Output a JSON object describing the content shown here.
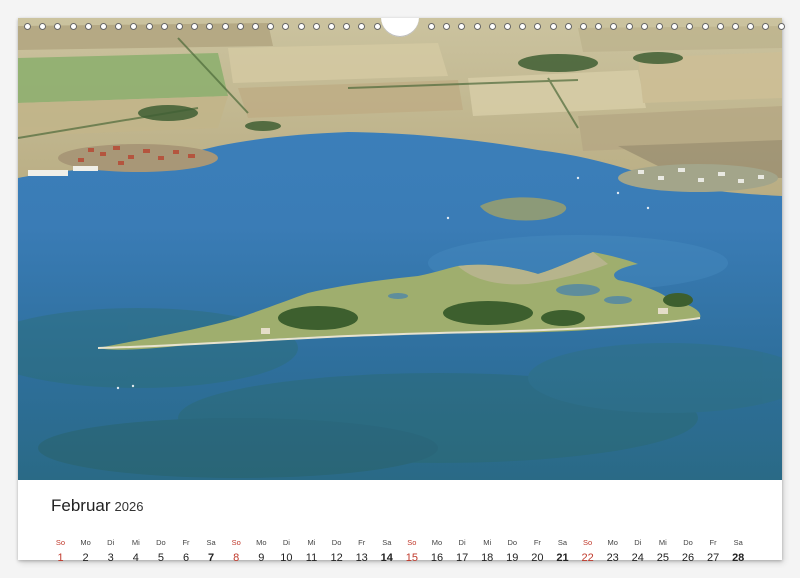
{
  "calendar": {
    "month": "Februar",
    "year": "2026",
    "days": [
      {
        "dow": "So",
        "num": "1"
      },
      {
        "dow": "Mo",
        "num": "2"
      },
      {
        "dow": "Di",
        "num": "3"
      },
      {
        "dow": "Mi",
        "num": "4"
      },
      {
        "dow": "Do",
        "num": "5"
      },
      {
        "dow": "Fr",
        "num": "6"
      },
      {
        "dow": "Sa",
        "num": "7"
      },
      {
        "dow": "So",
        "num": "8"
      },
      {
        "dow": "Mo",
        "num": "9"
      },
      {
        "dow": "Di",
        "num": "10"
      },
      {
        "dow": "Mi",
        "num": "11"
      },
      {
        "dow": "Do",
        "num": "12"
      },
      {
        "dow": "Fr",
        "num": "13"
      },
      {
        "dow": "Sa",
        "num": "14"
      },
      {
        "dow": "So",
        "num": "15"
      },
      {
        "dow": "Mo",
        "num": "16"
      },
      {
        "dow": "Di",
        "num": "17"
      },
      {
        "dow": "Mi",
        "num": "18"
      },
      {
        "dow": "Do",
        "num": "19"
      },
      {
        "dow": "Fr",
        "num": "20"
      },
      {
        "dow": "Sa",
        "num": "21"
      },
      {
        "dow": "So",
        "num": "22"
      },
      {
        "dow": "Mo",
        "num": "23"
      },
      {
        "dow": "Di",
        "num": "24"
      },
      {
        "dow": "Mi",
        "num": "25"
      },
      {
        "dow": "Do",
        "num": "26"
      },
      {
        "dow": "Fr",
        "num": "27"
      },
      {
        "dow": "Sa",
        "num": "28"
      }
    ]
  },
  "colors": {
    "sunday": "#c0392b",
    "water": "#2f6fa8",
    "land": "#c9bf98"
  }
}
